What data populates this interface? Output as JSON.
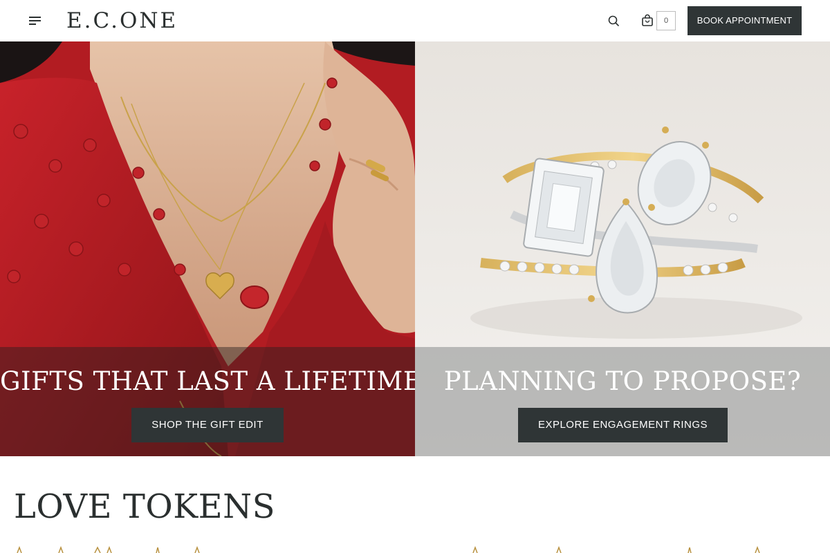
{
  "header": {
    "logo": "E.C.ONE",
    "cart_count": "0",
    "book_label": "BOOK APPOINTMENT"
  },
  "hero": {
    "left": {
      "title": "GIFTS THAT LAST A LIFETIME",
      "cta": "SHOP THE GIFT EDIT"
    },
    "right": {
      "title": "PLANNING TO PROPOSE?",
      "cta": "EXPLORE ENGAGEMENT RINGS"
    }
  },
  "section": {
    "title": "LOVE TOKENS"
  },
  "colors": {
    "dark_button": "#2f3536",
    "sweater_red": "#b81d22",
    "gold": "#c9a24a"
  }
}
